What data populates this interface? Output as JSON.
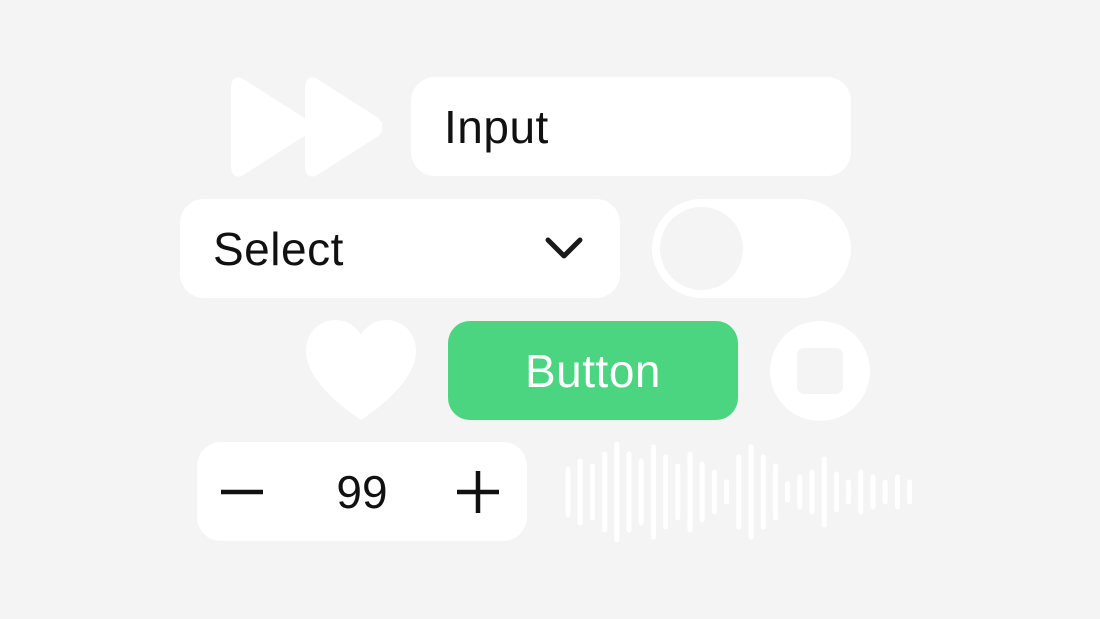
{
  "input": {
    "value": "Input"
  },
  "select": {
    "value": "Select"
  },
  "toggle": {
    "state": "off"
  },
  "button": {
    "label": "Button"
  },
  "stepper": {
    "value": "99"
  },
  "icons": {
    "fast_forward": "fast-forward-icon",
    "heart": "heart-icon",
    "stop": "stop-icon",
    "chevron": "chevron-down-icon",
    "minus": "minus-icon",
    "plus": "plus-icon",
    "waveform": "waveform-icon"
  },
  "colors": {
    "background": "#f4f4f4",
    "surface": "#ffffff",
    "accent": "#4cd580",
    "text": "#111111"
  }
}
